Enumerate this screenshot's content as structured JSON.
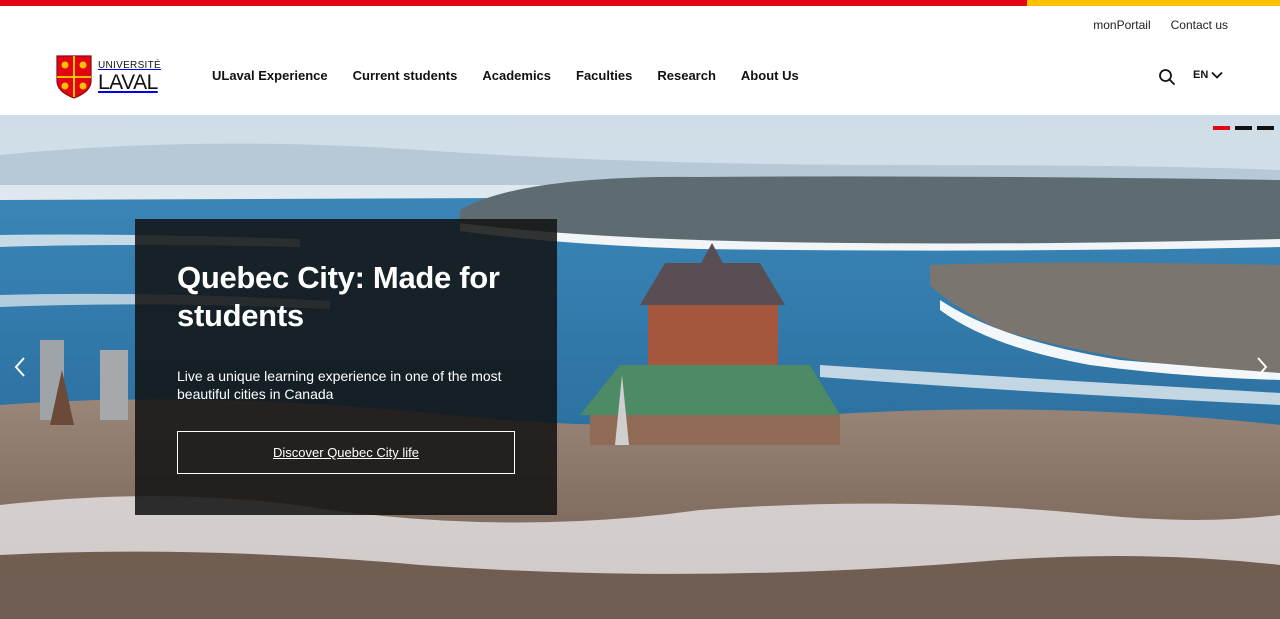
{
  "brand": {
    "name_small": "UNIVERSITÉ",
    "name_big": "LAVAL",
    "colors": {
      "red": "#e30513",
      "gold": "#ffc103",
      "dark": "#111111"
    },
    "logo_icon": "shield-crest-icon"
  },
  "utility_nav": [
    {
      "label": "monPortail"
    },
    {
      "label": "Contact us"
    }
  ],
  "main_nav": [
    {
      "label": "ULaval Experience"
    },
    {
      "label": "Current students"
    },
    {
      "label": "Academics"
    },
    {
      "label": "Faculties"
    },
    {
      "label": "Research"
    },
    {
      "label": "About Us"
    }
  ],
  "header_tools": {
    "search_icon": "search-icon",
    "language": "EN",
    "language_icon": "chevron-down-icon"
  },
  "hero": {
    "title": "Quebec City: Made for students",
    "text": "Live a unique learning experience in one of the most beautiful cities in Canada",
    "cta": "Discover Quebec City life",
    "slides_total": 3,
    "slide_active": 1,
    "prev_icon": "chevron-left-icon",
    "next_icon": "chevron-right-icon"
  }
}
